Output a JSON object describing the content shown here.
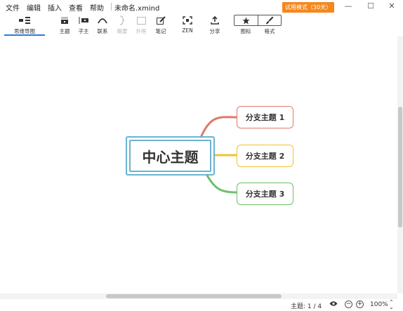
{
  "menu": {
    "items": [
      "文件",
      "编辑",
      "插入",
      "查看",
      "帮助"
    ],
    "document_title": "未命名.xmind"
  },
  "trial_badge": "试用模式（30天）",
  "window_controls": {
    "minimize": "—",
    "maximize": "☐",
    "close": "✕"
  },
  "toolbar": {
    "mindmap_tab": "思维导图",
    "topic": "主题",
    "subtopic": "子主",
    "relationship": "联系",
    "summary": "概要",
    "boundary": "外框",
    "notes": "笔记",
    "zen": "ZEN",
    "share": "分享",
    "icons": "图标",
    "format": "格式"
  },
  "mindmap": {
    "central_topic": "中心主题",
    "branches": [
      {
        "label": "分支主题 1",
        "color": "#e07a68"
      },
      {
        "label": "分支主题 2",
        "color": "#f0c330"
      },
      {
        "label": "分支主题 3",
        "color": "#6cc06a"
      }
    ],
    "central_border_color": "#6bb3d3"
  },
  "status": {
    "topic_count": "主题: 1 / 4",
    "zoom_out": "−",
    "zoom_in": "+",
    "zoom_level": "100%"
  },
  "icons": {
    "mindmap": "mindmap-icon",
    "topic": "topic-icon",
    "subtopic": "subtopic-icon",
    "relationship": "relationship-icon",
    "summary": "summary-icon",
    "boundary": "boundary-icon",
    "notes": "notes-icon",
    "zen": "zen-icon",
    "share": "share-icon",
    "icons": "star-icon",
    "format": "brush-icon",
    "view": "eye-icon"
  }
}
